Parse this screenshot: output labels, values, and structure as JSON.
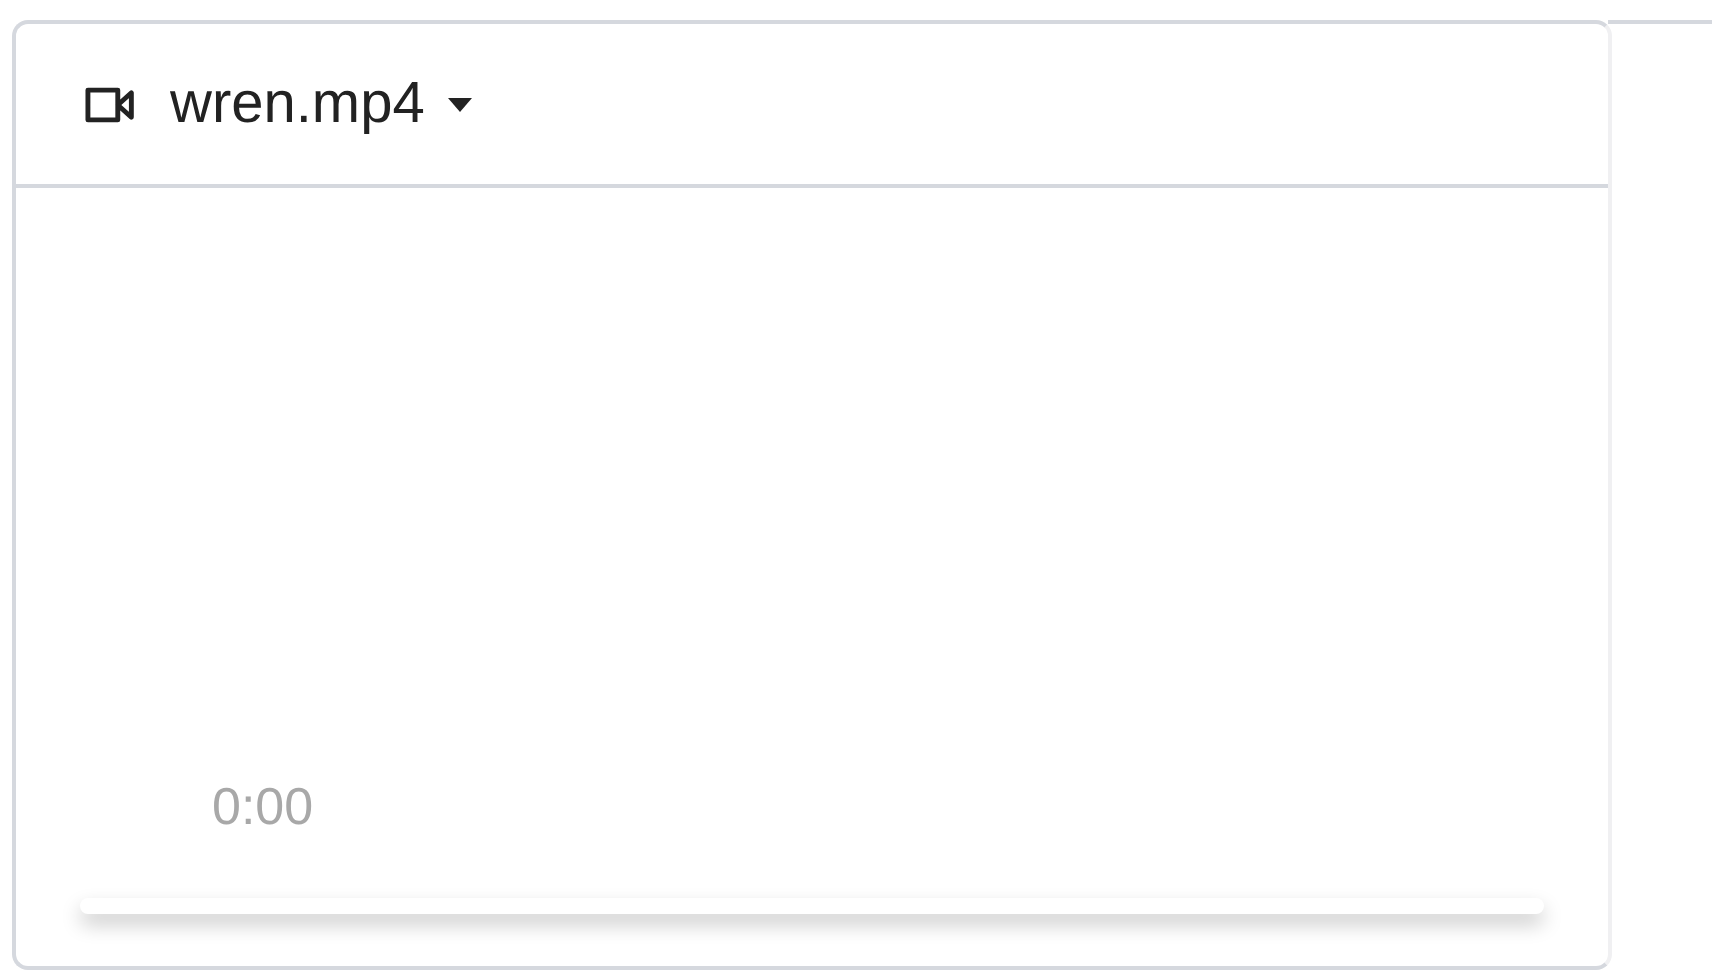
{
  "file": {
    "name": "wren.mp4"
  },
  "player": {
    "time": "0:00"
  }
}
